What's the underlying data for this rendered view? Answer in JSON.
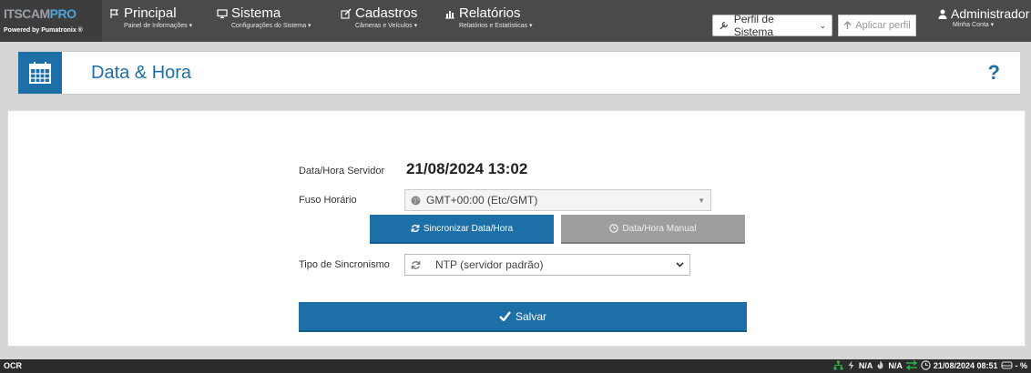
{
  "brand": {
    "logo_main": "ITSCAM",
    "logo_accent": "PRO",
    "powered": "Powered by Pumatronix ®"
  },
  "nav": {
    "principal": {
      "title": "Principal",
      "sub": "Painel de Informações ▾"
    },
    "sistema": {
      "title": "Sistema",
      "sub": "Configurações do Sistema ▾"
    },
    "cadastros": {
      "title": "Cadastros",
      "sub": "Câmeras e Veículos ▾"
    },
    "relatorios": {
      "title": "Relatórios",
      "sub": "Relatórios e Estatísticas ▾"
    }
  },
  "profile": {
    "label": "Perfil de Sistema",
    "caret": "⌄",
    "apply": "Aplicar perfil"
  },
  "user": {
    "name": "Administrador",
    "sub": "Minha Conta ▾"
  },
  "page": {
    "title": "Data & Hora",
    "help": "?"
  },
  "form": {
    "server_label": "Data/Hora Servidor",
    "server_value": "21/08/2024 13:02",
    "tz_label": "Fuso Horário",
    "tz_value": "GMT+00:00 (Etc/GMT)",
    "sync_button": "Sincronizar Data/Hora",
    "manual_button": "Data/Hora Manual",
    "sync_type_label": "Tipo de Sincronismo",
    "sync_type_value": "NTP (servidor padrão)",
    "save_button": "Salvar"
  },
  "status": {
    "left": "OCR",
    "na1": "N/A",
    "na2": "N/A",
    "datetime": "21/08/2024 08:51",
    "disk": "- %"
  },
  "colors": {
    "accent": "#1d6fa8",
    "topbar": "#4a4a4a",
    "green": "#27b34a"
  }
}
